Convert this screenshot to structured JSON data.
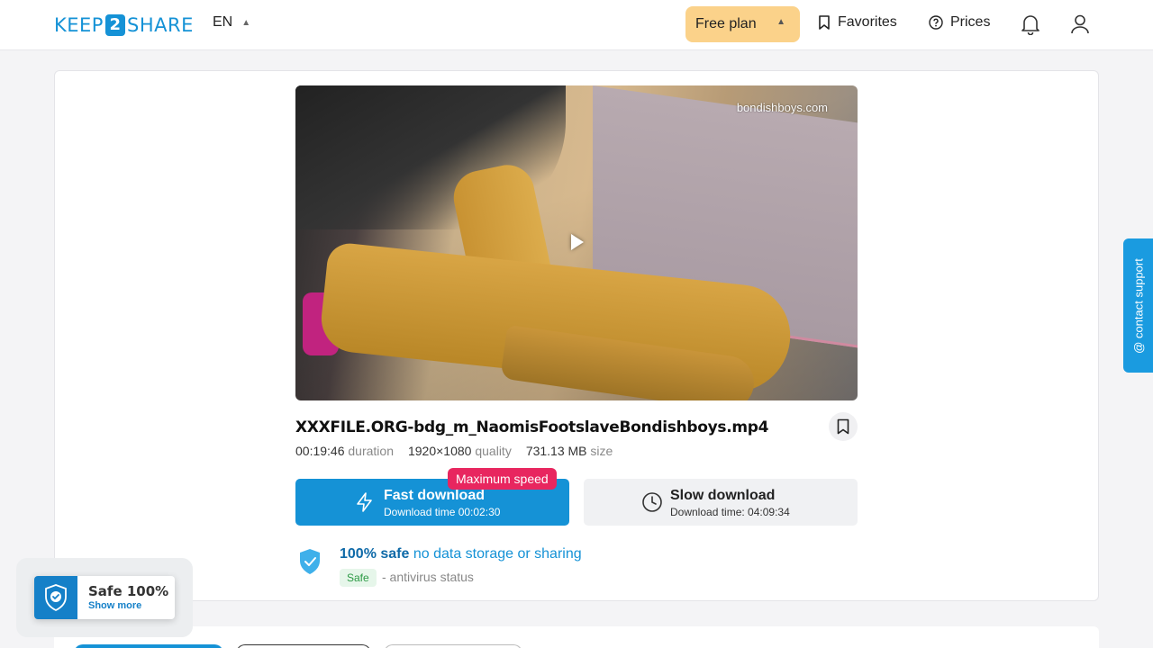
{
  "header": {
    "logo_left": "KEEP",
    "logo_mid": "2",
    "logo_right": "SHARE",
    "lang": "EN",
    "plan_label": "Free plan",
    "favorites_label": "Favorites",
    "prices_label": "Prices"
  },
  "video": {
    "watermark": "bondishboys.com"
  },
  "file": {
    "name": "XXXFILE.ORG-bdg_m_NaomisFootslaveBondishboys.mp4",
    "duration": "00:19:46",
    "duration_label": "duration",
    "quality": "1920×1080",
    "quality_label": "quality",
    "size": "731.13 MB",
    "size_label": "size"
  },
  "download": {
    "fast_title": "Fast download",
    "fast_sub": "Download time 00:02:30",
    "speed_badge": "Maximum speed",
    "slow_title": "Slow download",
    "slow_sub": "Download time: 04:09:34"
  },
  "safety": {
    "strong": "100% safe",
    "rest": "no data storage or sharing",
    "badge": "Safe",
    "antivirus": "- antivirus status"
  },
  "support": {
    "label": "@ contact support"
  },
  "safe_popup": {
    "title": "Safe 100%",
    "link": "Show more"
  },
  "colors": {
    "accent": "#1592d6",
    "plan": "#fbd28a",
    "badge": "#e8265f"
  }
}
